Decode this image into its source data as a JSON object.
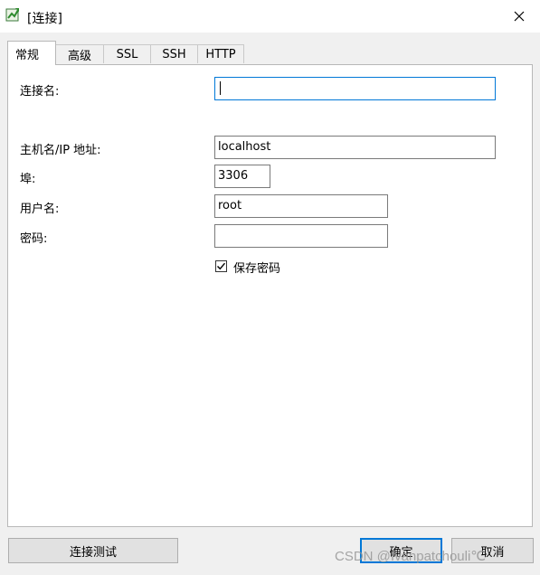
{
  "window": {
    "title": "[连接]",
    "close_icon": "close-icon",
    "app_icon": "connection-icon"
  },
  "tabs": [
    {
      "label": "常规",
      "active": true
    },
    {
      "label": "高级"
    },
    {
      "label": "SSL"
    },
    {
      "label": "SSH"
    },
    {
      "label": "HTTP"
    }
  ],
  "form": {
    "connection_name": {
      "label": "连接名:",
      "value": ""
    },
    "host": {
      "label": "主机名/IP 地址:",
      "value": "localhost"
    },
    "port": {
      "label": "埠:",
      "value": "3306"
    },
    "username": {
      "label": "用户名:",
      "value": "root"
    },
    "password": {
      "label": "密码:",
      "value": ""
    },
    "save_password": {
      "label": "保存密码",
      "checked": true
    }
  },
  "buttons": {
    "test": "连接测试",
    "ok": "确定",
    "cancel": "取消"
  },
  "watermark": "CSDN @Ivanpatchouli℃",
  "colors": {
    "focus_border": "#0078d7",
    "panel_bg": "#ffffff",
    "window_bg": "#f0f0f0"
  }
}
